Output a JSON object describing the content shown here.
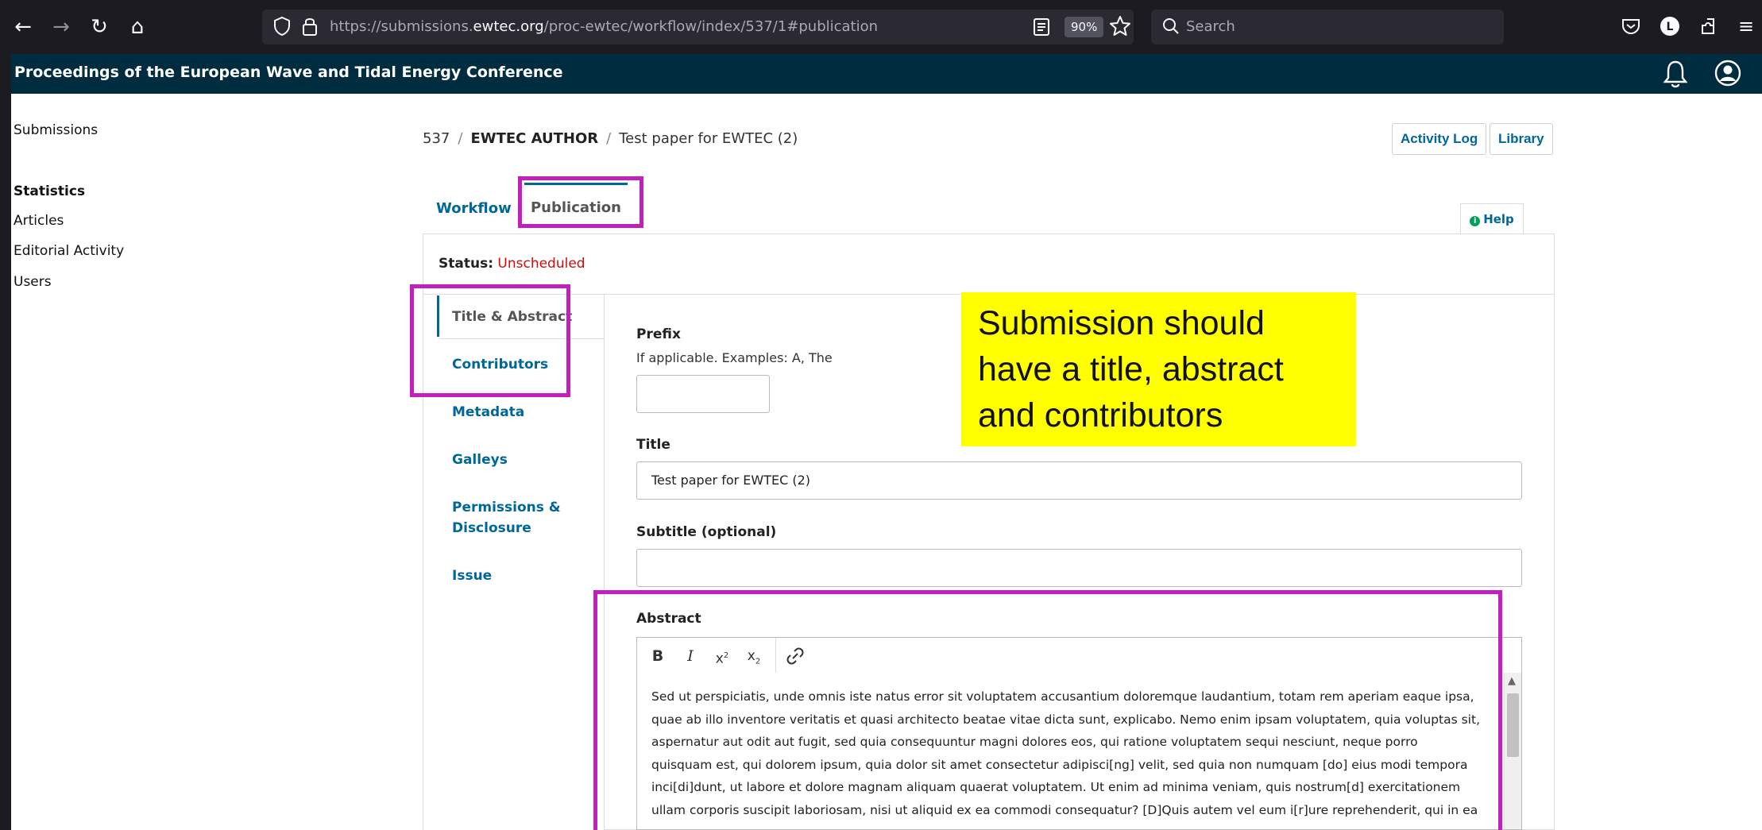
{
  "browser": {
    "url_prefix": "https://submissions.",
    "url_domain": "ewtec.org",
    "url_path": "/proc-ewtec/workflow/index/537/1#publication",
    "zoom": "90%",
    "search_placeholder": "Search",
    "profile_initial": "L"
  },
  "app": {
    "title": "Proceedings of the European Wave and Tidal Energy Conference"
  },
  "sidebar": {
    "submissions": "Submissions",
    "statistics_heading": "Statistics",
    "items": [
      "Articles",
      "Editorial Activity",
      "Users"
    ]
  },
  "breadcrumb": {
    "id": "537",
    "author": "EWTEC AUTHOR",
    "title": "Test paper for EWTEC (2)"
  },
  "buttons": {
    "activity_log": "Activity Log",
    "library": "Library",
    "help": "Help"
  },
  "tabs": {
    "workflow": "Workflow",
    "publication": "Publication"
  },
  "status": {
    "label": "Status:",
    "value": "Unscheduled"
  },
  "subnav": [
    "Title & Abstract",
    "Contributors",
    "Metadata",
    "Galleys",
    "Permissions &",
    "Disclosure",
    "Issue"
  ],
  "form": {
    "prefix_label": "Prefix",
    "prefix_desc": "If applicable. Examples: A, The",
    "prefix_value": "",
    "title_label": "Title",
    "title_value": "Test paper for EWTEC (2)",
    "subtitle_label": "Subtitle (optional)",
    "subtitle_value": "",
    "abstract_label": "Abstract",
    "abstract_lines": [
      "Sed ut perspiciatis, unde omnis iste natus error sit voluptatem accusantium doloremque laudantium, totam rem aperiam eaque ipsa,",
      "quae ab illo inventore veritatis et quasi architecto beatae vitae dicta sunt, explicabo. Nemo enim ipsam voluptatem, quia voluptas sit,",
      "aspernatur aut odit aut fugit, sed quia consequuntur magni dolores eos, qui ratione voluptatem sequi nesciunt, neque porro",
      "quisquam est, qui dolorem ipsum, quia dolor sit amet consectetur adipisci[ng] velit, sed quia non numquam [do] eius modi tempora",
      "inci[di]dunt, ut labore et dolore magnam aliquam quaerat voluptatem. Ut enim ad minima veniam, quis nostrum[d] exercitationem",
      "ullam corporis suscipit laboriosam, nisi ut aliquid ex ea commodi consequatur? [D]Quis autem vel eum i[r]ure reprehenderit, qui in ea"
    ]
  },
  "callout": {
    "lines": [
      "Submission should",
      "have a title, abstract",
      "and contributors"
    ],
    "background": "#ffff00"
  },
  "colors": {
    "header_bg": "#002c40",
    "link": "#006798",
    "status": "#d00a0a",
    "highlight": "#c21fbd"
  }
}
